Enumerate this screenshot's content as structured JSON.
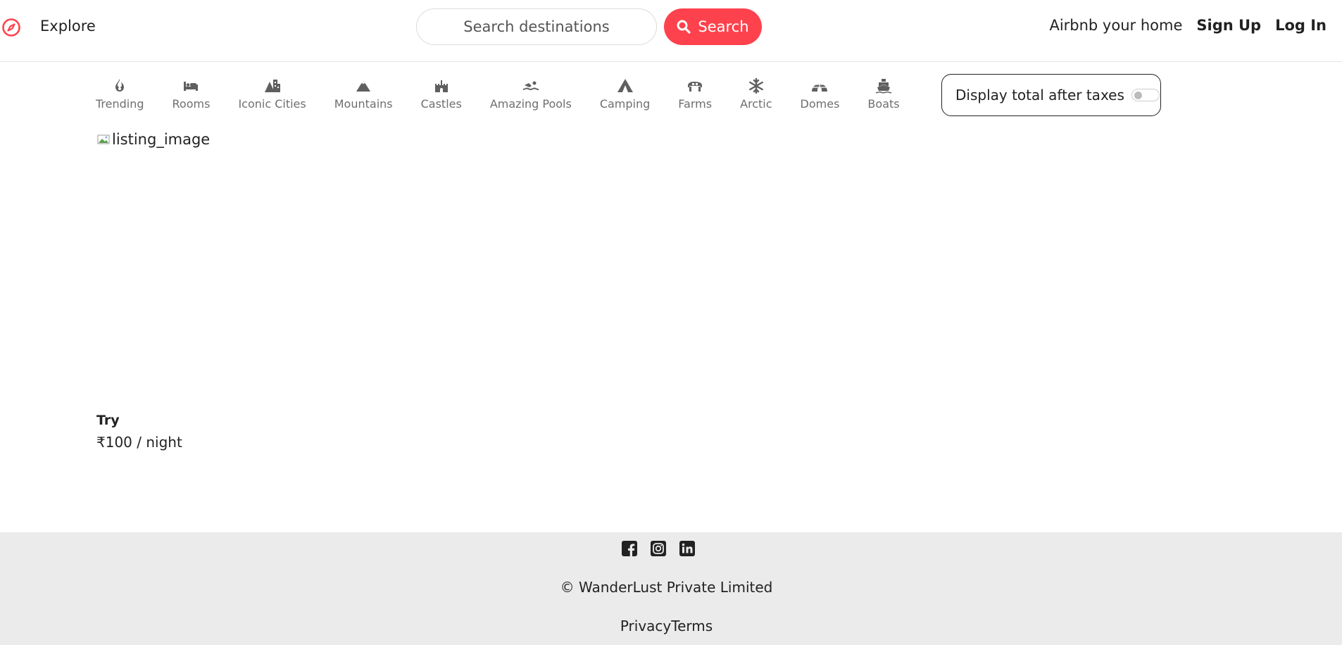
{
  "navbar": {
    "explore_label": "Explore",
    "search_placeholder": "Search destinations",
    "search_button_label": "Search",
    "host_link": "Airbnb your home",
    "signup_label": "Sign Up",
    "login_label": "Log In",
    "accent_color": "#fe424d"
  },
  "filters": [
    {
      "label": "Trending",
      "icon": "fire-icon"
    },
    {
      "label": "Rooms",
      "icon": "bed-icon"
    },
    {
      "label": "Iconic Cities",
      "icon": "city-icon"
    },
    {
      "label": "Mountains",
      "icon": "mountain-icon"
    },
    {
      "label": "Castles",
      "icon": "castle-icon"
    },
    {
      "label": "Amazing Pools",
      "icon": "swimmer-icon"
    },
    {
      "label": "Camping",
      "icon": "tent-icon"
    },
    {
      "label": "Farms",
      "icon": "tractor-icon"
    },
    {
      "label": "Arctic",
      "icon": "snowflake-icon"
    },
    {
      "label": "Domes",
      "icon": "igloo-icon"
    },
    {
      "label": "Boats",
      "icon": "ship-icon"
    }
  ],
  "tax_toggle": {
    "label": "Display total after taxes",
    "enabled": false
  },
  "listing": {
    "image_alt": "listing_image",
    "title": "Try",
    "price": "₹100 / night"
  },
  "footer": {
    "socials": [
      "facebook-icon",
      "instagram-icon",
      "linkedin-icon"
    ],
    "copyright": "© WanderLust Private Limited",
    "links": "PrivacyTerms"
  }
}
